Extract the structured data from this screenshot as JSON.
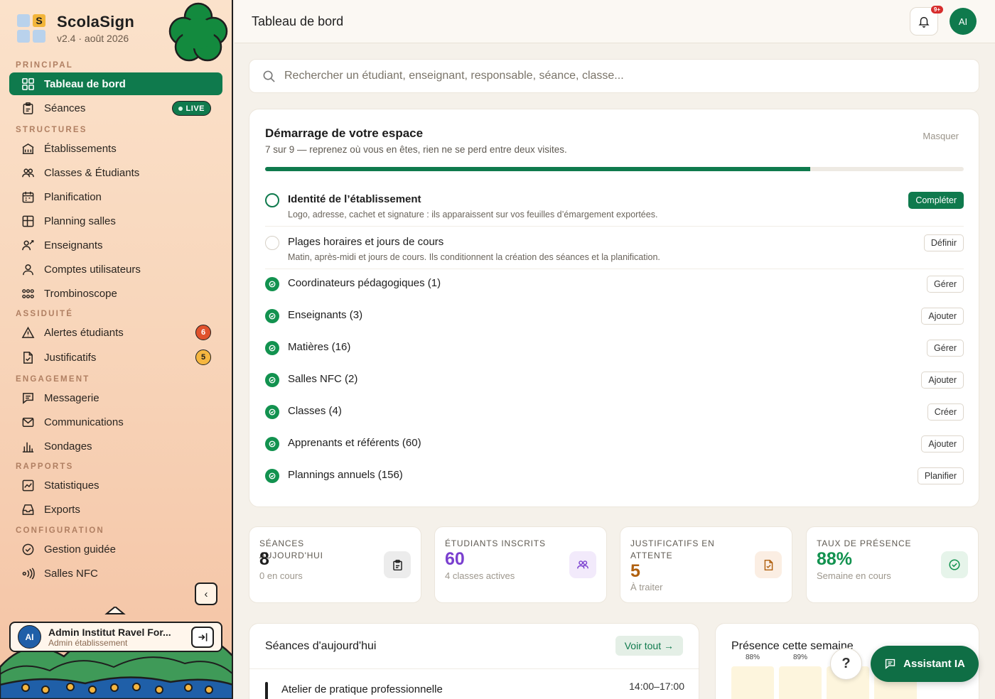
{
  "brand": {
    "name": "ScolaSign",
    "version": "v2.4 · août 2026",
    "logo_letter": "S"
  },
  "sidebar": {
    "sections": {
      "principal": "PRINCIPAL",
      "structures": "STRUCTURES",
      "assiduite": "ASSIDUITÉ",
      "engagement": "ENGAGEMENT",
      "rapports": "RAPPORTS",
      "configuration": "CONFIGURATION"
    },
    "items": {
      "dashboard": "Tableau de bord",
      "seances": "Séances",
      "live": "LIVE",
      "etablissements": "Établissements",
      "classes": "Classes & Étudiants",
      "planification": "Planification",
      "planning_salles": "Planning salles",
      "enseignants": "Enseignants",
      "comptes": "Comptes utilisateurs",
      "trombinoscope": "Trombinoscope",
      "alertes": "Alertes étudiants",
      "alertes_count": "6",
      "justificatifs": "Justificatifs",
      "justificatifs_count": "5",
      "messagerie": "Messagerie",
      "communications": "Communications",
      "sondages": "Sondages",
      "statistiques": "Statistiques",
      "exports": "Exports",
      "gestion": "Gestion guidée",
      "salles_nfc": "Salles NFC"
    },
    "collapse_icon": "‹",
    "user": {
      "initials": "AI",
      "name": "Admin Institut Ravel For...",
      "role": "Admin établissement"
    }
  },
  "header": {
    "title": "Tableau de bord",
    "notif_badge": "9+",
    "avatar": "AI"
  },
  "search": {
    "placeholder": "Rechercher un étudiant, enseignant, responsable, séance, classe..."
  },
  "onboarding": {
    "title": "Démarrage de votre espace",
    "subtitle": "7 sur 9 — reprenez où vous en êtes, rien ne se perd entre deux visites.",
    "hide": "Masquer",
    "progress": 0.78,
    "steps": [
      {
        "title": "Identité de l’établissement",
        "desc": "Logo, adresse, cachet et signature : ils apparaissent sur vos feuilles d’émargement exportées.",
        "button": "Compléter",
        "state": "current"
      },
      {
        "title": "Plages horaires et jours de cours",
        "desc": "Matin, après-midi et jours de cours. Ils conditionnent la création des séances et la planification.",
        "button": "Définir",
        "state": "open"
      },
      {
        "title": "Coordinateurs pédagogiques (1)",
        "button": "Gérer",
        "state": "done"
      },
      {
        "title": "Enseignants (3)",
        "button": "Ajouter",
        "state": "done"
      },
      {
        "title": "Matières (16)",
        "button": "Gérer",
        "state": "done"
      },
      {
        "title": "Salles NFC (2)",
        "button": "Ajouter",
        "state": "done"
      },
      {
        "title": "Classes (4)",
        "button": "Créer",
        "state": "done"
      },
      {
        "title": "Apprenants et référents (60)",
        "button": "Ajouter",
        "state": "done"
      },
      {
        "title": "Plannings annuels (156)",
        "button": "Planifier",
        "state": "done"
      }
    ]
  },
  "stats": [
    {
      "label": "SÉANCES AUJOURD'HUI",
      "value": "8",
      "sub": "0 en cours",
      "color": "#1e1e1e"
    },
    {
      "label": "ÉTUDIANTS INSCRITS",
      "value": "60",
      "sub": "4 classes actives",
      "color": "#7a3fcf"
    },
    {
      "label": "JUSTIFICATIFS EN ATTENTE",
      "value": "5",
      "sub": "À traiter",
      "color": "#b0600f"
    },
    {
      "label": "TAUX DE PRÉSENCE",
      "value": "88%",
      "sub": "Semaine en cours",
      "color": "#12924f"
    }
  ],
  "sessions": {
    "title": "Séances d'aujourd'hui",
    "see_all": "Voir tout →",
    "first": {
      "name": "Atelier de pratique professionnelle",
      "time": "14:00–17:00"
    }
  },
  "presence": {
    "title": "Présence cette semaine",
    "labels": [
      "88%",
      "89%"
    ]
  },
  "help": "?",
  "assistant": "Assistant IA"
}
